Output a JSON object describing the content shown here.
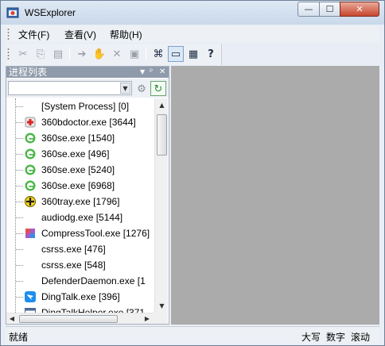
{
  "window": {
    "title": "WSExplorer",
    "controls": {
      "minimize": "—",
      "maximize": "☐",
      "close": "✕"
    }
  },
  "menu": {
    "items": [
      {
        "label": "文件(F)"
      },
      {
        "label": "查看(V)"
      },
      {
        "label": "帮助(H)"
      }
    ]
  },
  "toolbar": {
    "buttons": [
      {
        "icon": "cut-icon",
        "glyph": "✂",
        "enabled": false
      },
      {
        "icon": "copy-icon",
        "glyph": "⎘",
        "enabled": false
      },
      {
        "icon": "paste-icon",
        "glyph": "▤",
        "enabled": false
      },
      {
        "icon": "arrow-right-icon",
        "glyph": "➔",
        "enabled": false
      },
      {
        "icon": "hand-icon",
        "glyph": "✋",
        "enabled": false
      },
      {
        "icon": "delete-icon",
        "glyph": "✕",
        "enabled": false
      },
      {
        "icon": "save-icon",
        "glyph": "▣",
        "enabled": false
      },
      {
        "icon": "network-icon",
        "glyph": "⌘",
        "enabled": true
      },
      {
        "icon": "window-icon",
        "glyph": "▭",
        "enabled": true,
        "pressed": true
      },
      {
        "icon": "properties-icon",
        "glyph": "▦",
        "enabled": true
      },
      {
        "icon": "help-icon",
        "glyph": "?",
        "enabled": true
      }
    ]
  },
  "process_panel": {
    "title": "进程列表",
    "header_buttons": {
      "dropdown": "▼",
      "pin": "ᵖ",
      "close": "✕"
    },
    "combo": {
      "value": "",
      "arrow": "▼"
    },
    "settings_button": "⚙",
    "refresh_button": "↻",
    "processes": [
      {
        "label": "[System Process] [0]",
        "icon": "none"
      },
      {
        "label": "360bdoctor.exe [3644]",
        "icon": "doctor-icon"
      },
      {
        "label": "360se.exe [1540]",
        "icon": "browser-360se-icon"
      },
      {
        "label": "360se.exe [496]",
        "icon": "browser-360se-icon"
      },
      {
        "label": "360se.exe [5240]",
        "icon": "browser-360se-icon"
      },
      {
        "label": "360se.exe [6968]",
        "icon": "browser-360se-icon"
      },
      {
        "label": "360tray.exe [1796]",
        "icon": "shield-360-icon"
      },
      {
        "label": "audiodg.exe [5144]",
        "icon": "none"
      },
      {
        "label": "CompressTool.exe [1276]",
        "icon": "compress-icon"
      },
      {
        "label": "csrss.exe [476]",
        "icon": "none"
      },
      {
        "label": "csrss.exe [548]",
        "icon": "none"
      },
      {
        "label": "DefenderDaemon.exe [1",
        "icon": "none"
      },
      {
        "label": "DingTalk.exe [396]",
        "icon": "dingtalk-icon"
      },
      {
        "label": "DingTalkHelper.exe [371",
        "icon": "app-window-icon"
      }
    ],
    "scroll": {
      "up": "▲",
      "down": "▼",
      "left": "◀",
      "right": "▶"
    }
  },
  "statusbar": {
    "text": "就绪",
    "indicators": [
      "大写",
      "数字",
      "滚动"
    ]
  },
  "colors": {
    "workspace": "#ababab",
    "panel_header": "#8f9bab",
    "chrome": "#edf0f4"
  }
}
